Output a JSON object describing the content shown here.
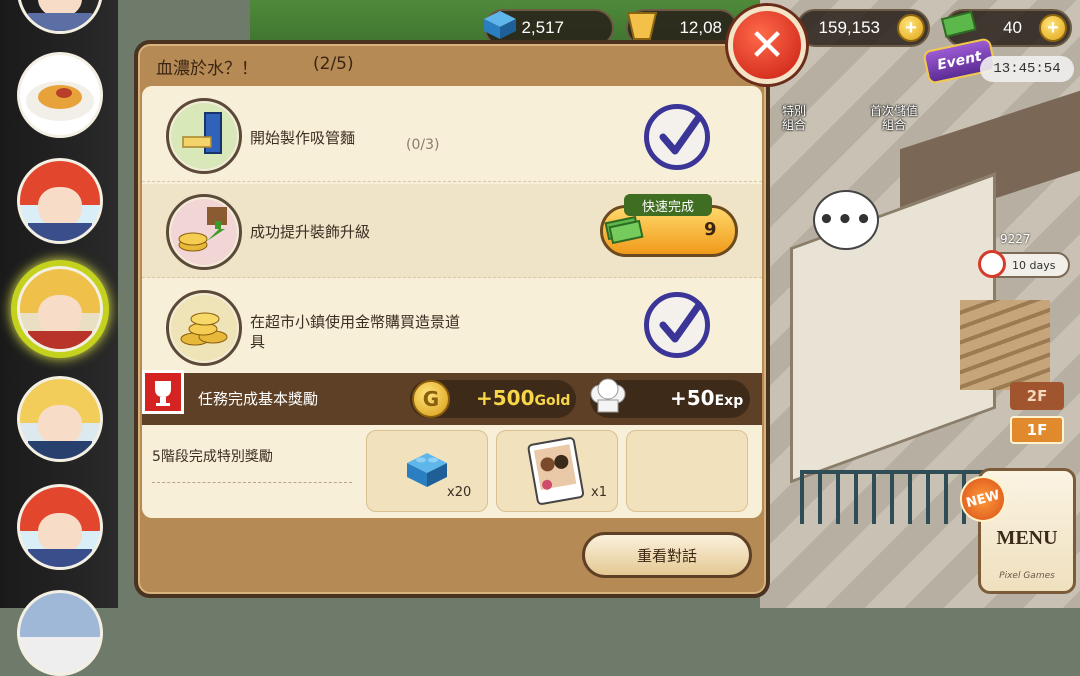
{
  "hud": {
    "bricks": "2,517",
    "pasta": "12,08",
    "gold": "159,153",
    "cash": "40",
    "event_label": "Event",
    "event_timer": "13:45:54"
  },
  "scene": {
    "label_special_bundle": "特別\n組合",
    "label_first_topup_bundle": "首次儲值\n組合",
    "speech_dots": "•••",
    "item_count": "9227",
    "days_badge": "10 days",
    "floor_2f": "2F",
    "floor_1f": "1F",
    "new_badge": "NEW",
    "menu_label": "MENU",
    "menu_sub": "Pixel Games"
  },
  "dialog": {
    "title": "血濃於水？！",
    "progress": "(2/5)",
    "close_symbol": "✕",
    "tasks": [
      {
        "text": "開始製作吸管麵",
        "status": "completed"
      },
      {
        "text": "成功提升裝飾升級",
        "progress": "(0/3)",
        "status": "in-progress"
      },
      {
        "text": "在超市小鎮使用金幣購買造景道具",
        "status": "completed"
      }
    ],
    "quick_complete": {
      "label": "快速完成",
      "cost": "9"
    },
    "basic_reward": {
      "label": "任務完成基本獎勵",
      "gold_amount": "+500",
      "gold_unit": "Gold",
      "exp_amount": "+50",
      "exp_unit": "Exp"
    },
    "special_reward": {
      "label": "5階段完成特別獎勵",
      "items": [
        {
          "icon": "blue-brick-icon",
          "qty": "x20"
        },
        {
          "icon": "photo-card-icon",
          "qty": "x1"
        }
      ]
    },
    "review_button": "重看對話"
  },
  "colors": {
    "dialog_bg": "#b58a55",
    "panel_bg": "#f8efd9",
    "check_blue": "#3a3596",
    "close_red": "#c81d12",
    "quick_orange": "#f09a1a",
    "gold_text": "#f7d64a"
  }
}
